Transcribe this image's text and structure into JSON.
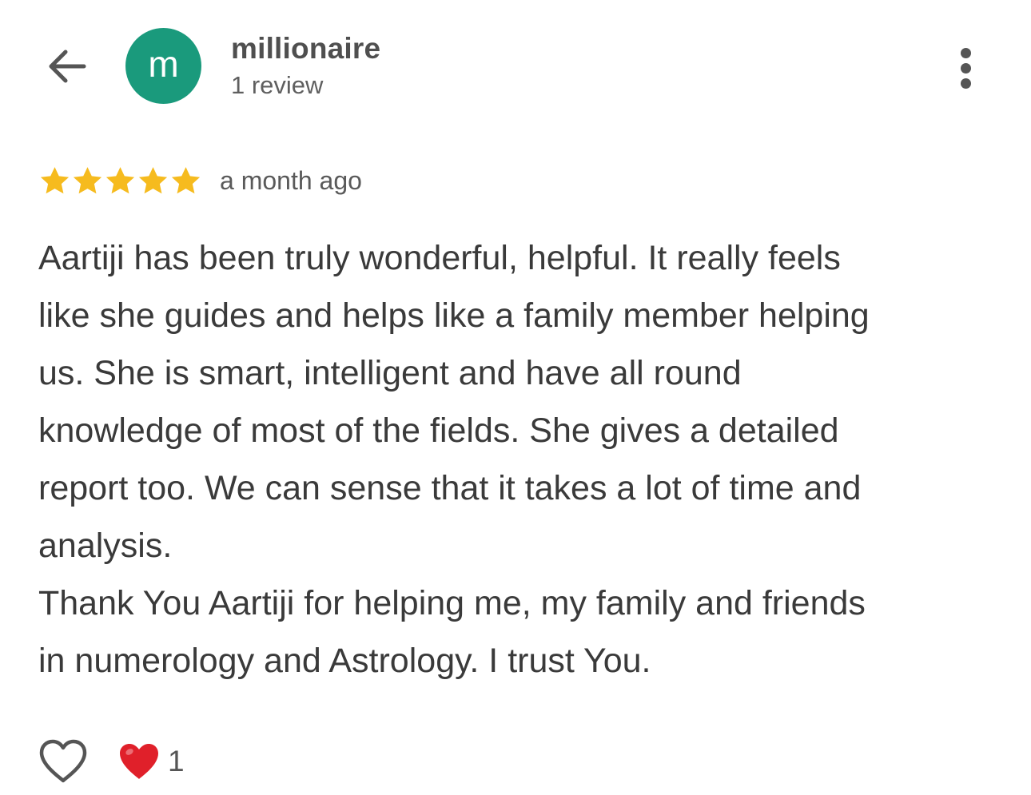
{
  "header": {
    "avatar_letter": "m",
    "avatar_color": "#1a9a7c",
    "user_name": "millionaire",
    "review_count": "1 review",
    "back_icon": "arrow-left-icon",
    "menu_icon": "more-vertical-icon"
  },
  "review": {
    "rating": 5,
    "rating_max": 5,
    "star_color": "#f6bb1e",
    "date": "a month ago",
    "lines": [
      "Aartiji has been truly wonderful, helpful. It really feels",
      "like she guides and helps like a family member helping",
      "us. She is smart, intelligent and have all round",
      "knowledge of most of the fields. She gives a detailed",
      "report too. We can sense that it takes a lot of time and",
      "analysis.",
      "Thank You Aartiji for helping me, my family and friends",
      "in numerology and Astrology. I trust You."
    ]
  },
  "reactions": {
    "like_icon": "heart-outline-icon",
    "reaction_icon": "red-heart-icon",
    "heart_color": "#e0202a",
    "count": "1"
  }
}
